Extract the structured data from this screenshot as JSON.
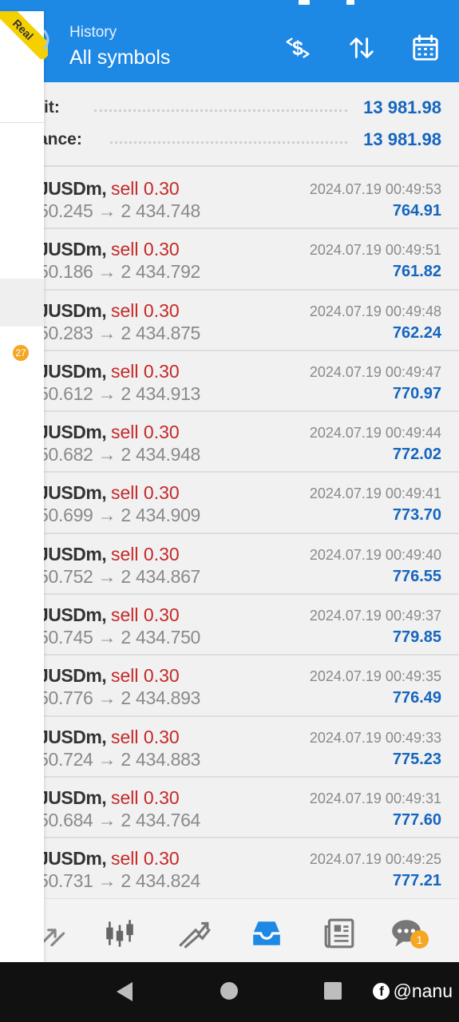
{
  "header": {
    "title": "History",
    "subtitle": "All symbols",
    "actions": [
      {
        "name": "currency-exchange-icon"
      },
      {
        "name": "sort-icon"
      },
      {
        "name": "calendar-icon"
      }
    ]
  },
  "summary": {
    "profit_label": "fit:",
    "profit_value": "13 981.98",
    "balance_label": "ance:",
    "balance_value": "13 981.98"
  },
  "deals": [
    {
      "symbol": "JUSDm,",
      "side": "sell 0.30",
      "prices": "50.245 → 2 434.748",
      "time": "2024.07.19 00:49:53",
      "profit": "764.91"
    },
    {
      "symbol": "JUSDm,",
      "side": "sell 0.30",
      "prices": "50.186 → 2 434.792",
      "time": "2024.07.19 00:49:51",
      "profit": "761.82"
    },
    {
      "symbol": "JUSDm,",
      "side": "sell 0.30",
      "prices": "50.283 → 2 434.875",
      "time": "2024.07.19 00:49:48",
      "profit": "762.24"
    },
    {
      "symbol": "JUSDm,",
      "side": "sell 0.30",
      "prices": "50.612 → 2 434.913",
      "time": "2024.07.19 00:49:47",
      "profit": "770.97"
    },
    {
      "symbol": "JUSDm,",
      "side": "sell 0.30",
      "prices": "50.682 → 2 434.948",
      "time": "2024.07.19 00:49:44",
      "profit": "772.02"
    },
    {
      "symbol": "JUSDm,",
      "side": "sell 0.30",
      "prices": "50.699 → 2 434.909",
      "time": "2024.07.19 00:49:41",
      "profit": "773.70"
    },
    {
      "symbol": "JUSDm,",
      "side": "sell 0.30",
      "prices": "50.752 → 2 434.867",
      "time": "2024.07.19 00:49:40",
      "profit": "776.55"
    },
    {
      "symbol": "JUSDm,",
      "side": "sell 0.30",
      "prices": "50.745 → 2 434.750",
      "time": "2024.07.19 00:49:37",
      "profit": "779.85"
    },
    {
      "symbol": "JUSDm,",
      "side": "sell 0.30",
      "prices": "50.776 → 2 434.893",
      "time": "2024.07.19 00:49:35",
      "profit": "776.49"
    },
    {
      "symbol": "JUSDm,",
      "side": "sell 0.30",
      "prices": "50.724 → 2 434.883",
      "time": "2024.07.19 00:49:33",
      "profit": "775.23"
    },
    {
      "symbol": "JUSDm,",
      "side": "sell 0.30",
      "prices": "50.684 → 2 434.764",
      "time": "2024.07.19 00:49:31",
      "profit": "777.60"
    },
    {
      "symbol": "JUSDm,",
      "side": "sell 0.30",
      "prices": "50.731 → 2 434.824",
      "time": "2024.07.19 00:49:25",
      "profit": "777.21"
    }
  ],
  "bottom_nav": [
    {
      "name": "quotes-icon"
    },
    {
      "name": "chart-candles-icon"
    },
    {
      "name": "trade-icon"
    },
    {
      "name": "history-inbox-icon",
      "active": true
    },
    {
      "name": "news-icon"
    },
    {
      "name": "chat-icon",
      "badge": "1"
    }
  ],
  "drawer": {
    "ribbon": "Real",
    "badge": "27"
  },
  "watermark": {
    "icon": "f",
    "text": "@nanu"
  },
  "colors": {
    "header_bg": "#1e88e5",
    "profit_blue": "#1565c0",
    "sell_red": "#c62828",
    "badge_orange": "#f5a623",
    "active_nav": "#1e88e5"
  }
}
